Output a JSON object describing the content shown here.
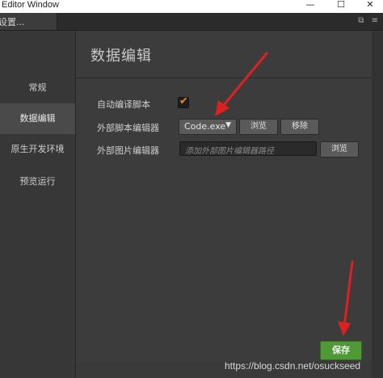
{
  "window": {
    "title": "Editor Window",
    "minimize": "—",
    "maximize": "☐",
    "close": "✕"
  },
  "tab": {
    "label": "设置..."
  },
  "sidebar": {
    "items": [
      {
        "label": "常规"
      },
      {
        "label": "数据编辑"
      },
      {
        "label": "原生开发环境"
      },
      {
        "label": "预览运行"
      }
    ],
    "active_index": 1
  },
  "main": {
    "heading": "数据编辑",
    "auto_compile": {
      "label": "自动编译脚本",
      "checked": true,
      "check_glyph": "✔"
    },
    "script_editor": {
      "label": "外部脚本编辑器",
      "selected": "Code.exe",
      "caret": "▼",
      "browse_label": "浏览",
      "remove_label": "移除"
    },
    "image_editor": {
      "label": "外部图片编辑器",
      "placeholder": "添加外部图片编辑器路径",
      "browse_label": "浏览"
    },
    "save_label": "保存"
  },
  "watermark": "https://blog.csdn.net/osuckseed",
  "colors": {
    "accent_check": "#f08a1c",
    "save_green": "#4f9a37",
    "arrow_red": "#e02020"
  }
}
